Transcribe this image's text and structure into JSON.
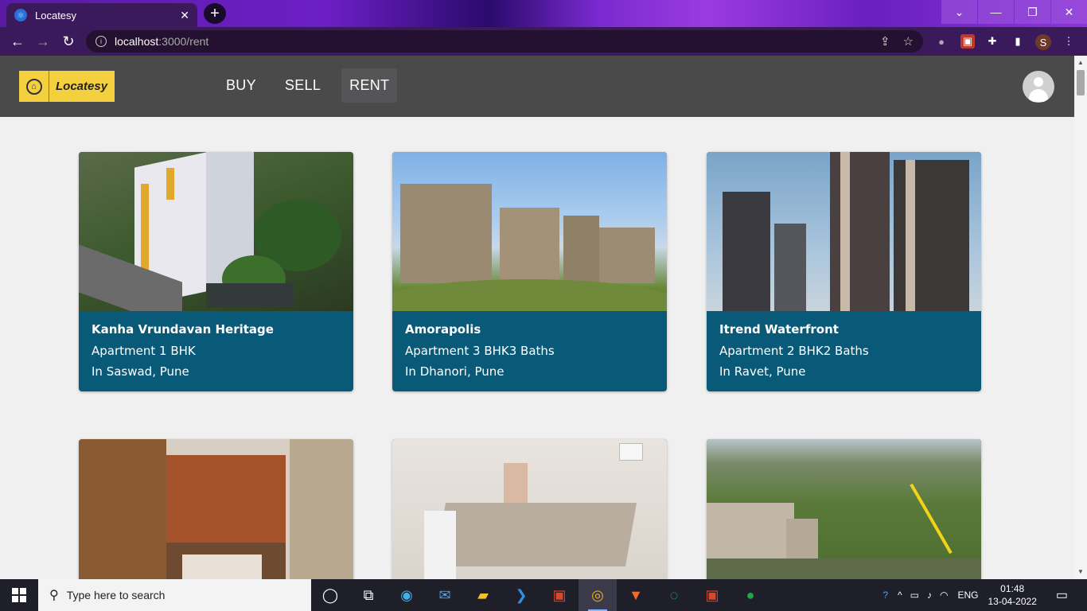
{
  "browser": {
    "tab_title": "Locatesy",
    "url_host": "localhost",
    "url_path": ":3000/rent",
    "new_tab": "+",
    "tab_close": "✕",
    "profile_initial": "S"
  },
  "app": {
    "logo_text": "Locatesy",
    "nav": [
      {
        "label": "BUY"
      },
      {
        "label": "SELL"
      },
      {
        "label": "RENT"
      }
    ],
    "active_nav": "RENT"
  },
  "listings": [
    {
      "name": "Kanha Vrundavan Heritage",
      "type": "Apartment 1 BHK",
      "location": "In Saswad, Pune"
    },
    {
      "name": "Amorapolis",
      "type": "Apartment 3 BHK3 Baths",
      "location": "In Dhanori, Pune"
    },
    {
      "name": "Itrend Waterfront",
      "type": "Apartment 2 BHK2 Baths",
      "location": "In Ravet, Pune"
    },
    {
      "name": "",
      "type": "",
      "location": ""
    },
    {
      "name": "",
      "type": "",
      "location": ""
    },
    {
      "name": "",
      "type": "",
      "location": ""
    }
  ],
  "taskbar": {
    "search_placeholder": "Type here to search",
    "language": "ENG",
    "time": "01:48",
    "date": "13-04-2022"
  },
  "colors": {
    "card_bg": "#085a78",
    "appbar_bg": "#4a4a4a",
    "logo_bg": "#f4d03f"
  }
}
